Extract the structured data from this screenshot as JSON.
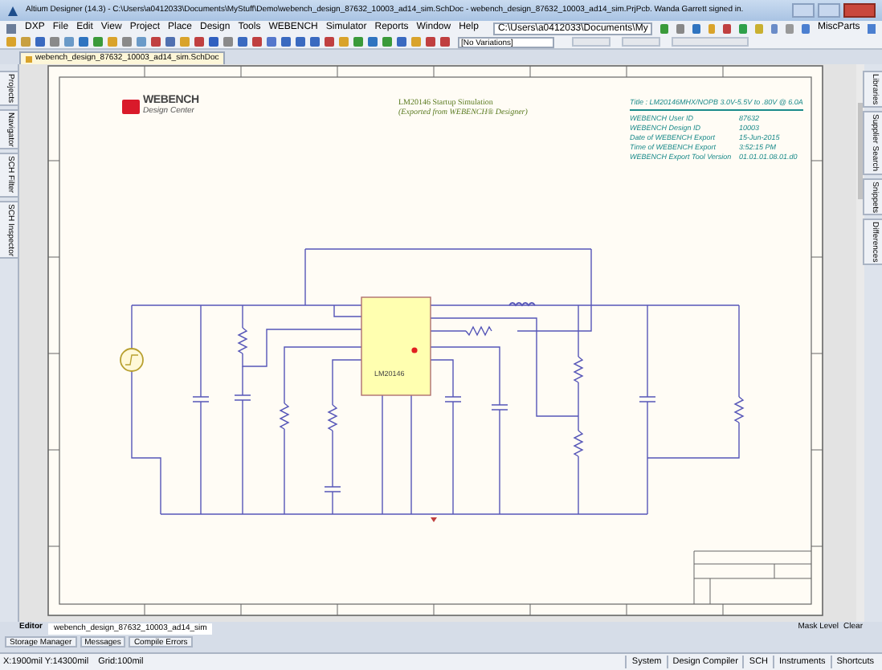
{
  "window": {
    "title": "Altium Designer (14.3) - C:\\Users\\a0412033\\Documents\\MyStuff\\Demo\\webench_design_87632_10003_ad14_sim.SchDoc - webench_design_87632_10003_ad14_sim.PrjPcb. Wanda Garrett signed in."
  },
  "menu": [
    "DXP",
    "File",
    "Edit",
    "View",
    "Project",
    "Place",
    "Design",
    "Tools",
    "WEBENCH",
    "Simulator",
    "Reports",
    "Window",
    "Help"
  ],
  "path_field": {
    "value": "C:\\Users\\a0412033\\Documents\\My"
  },
  "variations": {
    "value": "[No Variations]"
  },
  "misc_parts": "MiscParts",
  "document_tabs": [
    {
      "label": "webench_design_87632_10003_ad14_sim.SchDoc",
      "selected": true
    }
  ],
  "left_panels": [
    "Projects",
    "Navigator",
    "SCH Filter",
    "SCH Inspector"
  ],
  "right_panels": [
    "Libraries",
    "Supplier Search",
    "Snippets",
    "Differences"
  ],
  "sheet": {
    "logo": {
      "name": "WEBENCH",
      "tagline": "Design Center"
    },
    "notes": [
      "LM20146 Startup Simulation",
      "(Exported from WEBENCH® Designer)"
    ],
    "title": "Title : LM20146MHX/NOPB 3.0V-5.5V to .80V @ 6.0A",
    "info": [
      {
        "label": "WEBENCH User ID",
        "value": "87632"
      },
      {
        "label": "WEBENCH Design ID",
        "value": "10003"
      },
      {
        "label": "Date of WEBENCH Export",
        "value": "15-Jun-2015"
      },
      {
        "label": "Time of WEBENCH Export",
        "value": "3:52:15 PM"
      },
      {
        "label": "WEBENCH Export Tool Version",
        "value": "01.01.01.08.01.d0"
      }
    ],
    "chip_label": "LM20146"
  },
  "editor_label": "Editor",
  "editor_tabs": [
    {
      "label": "webench_design_87632_10003_ad14_sim",
      "selected": true
    }
  ],
  "mask": [
    "Mask Level",
    "Clear"
  ],
  "bottom_panels": [
    "Storage Manager",
    "Messages",
    "Compile Errors"
  ],
  "status_bar": {
    "coords": "X:1900mil Y:14300mil",
    "grid": "Grid:100mil",
    "buttons": [
      "System",
      "Design Compiler",
      "SCH",
      "Instruments",
      "Shortcuts"
    ]
  }
}
